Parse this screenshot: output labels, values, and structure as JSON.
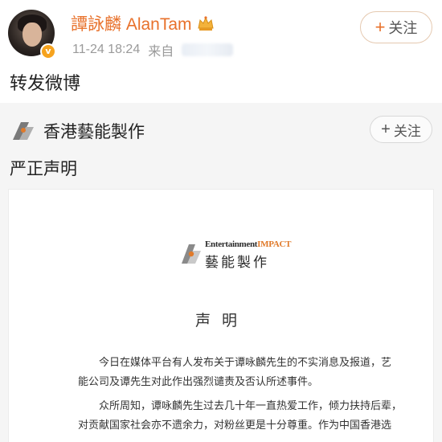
{
  "post": {
    "username": "譚詠麟 AlanTam",
    "timestamp": "11-24 18:24",
    "source_prefix": "来自",
    "follow_label": "关注",
    "follow_icon": "plus-icon",
    "content": "转发微博"
  },
  "retweet": {
    "account_name": "香港藝能製作",
    "follow_label": "关注",
    "content": "严正声明"
  },
  "statement": {
    "logo_en_left": "Entertainment",
    "logo_en_right": "IMPACT",
    "logo_cn": "藝能製作",
    "title": "声明",
    "para1_line1": "今日在媒体平台有人发布关于谭咏麟先生的不实消息及报道，艺",
    "para1_line2": "能公司及谭先生对此作出强烈谴责及否认所述事件。",
    "para2_line1": "众所周知，谭咏麟先生过去几十年一直热爱工作，倾力扶持后辈，",
    "para2_line2": "对贡献国家社会亦不遗余力，对粉丝更是十分尊重。作为中国香港选"
  },
  "colors": {
    "username": "#e8712b",
    "accent_orange": "#e07a2a",
    "meta_gray": "#9a9a9a",
    "retweet_bg": "#f5f5f5"
  }
}
